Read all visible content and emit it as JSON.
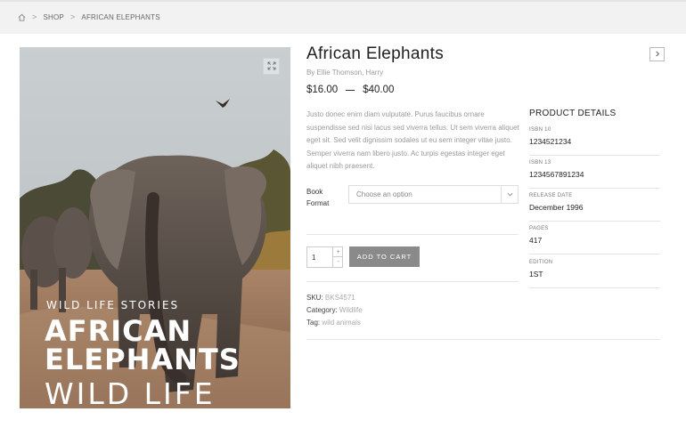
{
  "breadcrumb": {
    "home_icon": "home-icon",
    "items": [
      "SHOP",
      "AFRICAN ELEPHANTS"
    ],
    "separator": ">"
  },
  "cover": {
    "subtitle": "WILD LIFE STORIES",
    "title_line1": "AFRICAN",
    "title_line2": "ELEPHANTS",
    "title_line3": "WILD LIFE",
    "zoom_icon": "expand-icon"
  },
  "product": {
    "title": "African Elephants",
    "author": "By Ellie Thomson, Harry",
    "price_min": "$16.00",
    "price_max": "$40.00",
    "description": "Justo donec enim diam vulputate. Purus faucibus ornare suspendisse sed nisi lacus sed viverra tellus. Ut sem viverra aliquet eget sit. Sed velit dignissim sodales ut eu sem integer vitae justo. Semper viverra nam libero justo. Ac turpis egestas integer eget aliquet nibh praesent.",
    "format_label": "Book Format",
    "format_placeholder": "Choose an option",
    "quantity": "1",
    "add_to_cart": "ADD TO CART",
    "sku_label": "SKU:",
    "sku_value": "BKS4571",
    "category_label": "Category:",
    "category_value": "Wildlife",
    "tag_label": "Tag:",
    "tag_value": "wild animals",
    "next_icon": "chevron-right-icon"
  },
  "details": {
    "heading": "PRODUCT DETAILS",
    "rows": [
      {
        "label": "ISBN 10",
        "value": "1234521234"
      },
      {
        "label": "ISBN 13",
        "value": "1234567891234"
      },
      {
        "label": "RELEASE DATE",
        "value": "December 1996"
      },
      {
        "label": "PAGES",
        "value": "417"
      },
      {
        "label": "EDITION",
        "value": "1ST"
      }
    ]
  },
  "colors": {
    "button_bg": "#8a8a8a",
    "breadcrumb_bg": "#f2f2f2",
    "muted_text": "#9a9a9a"
  }
}
